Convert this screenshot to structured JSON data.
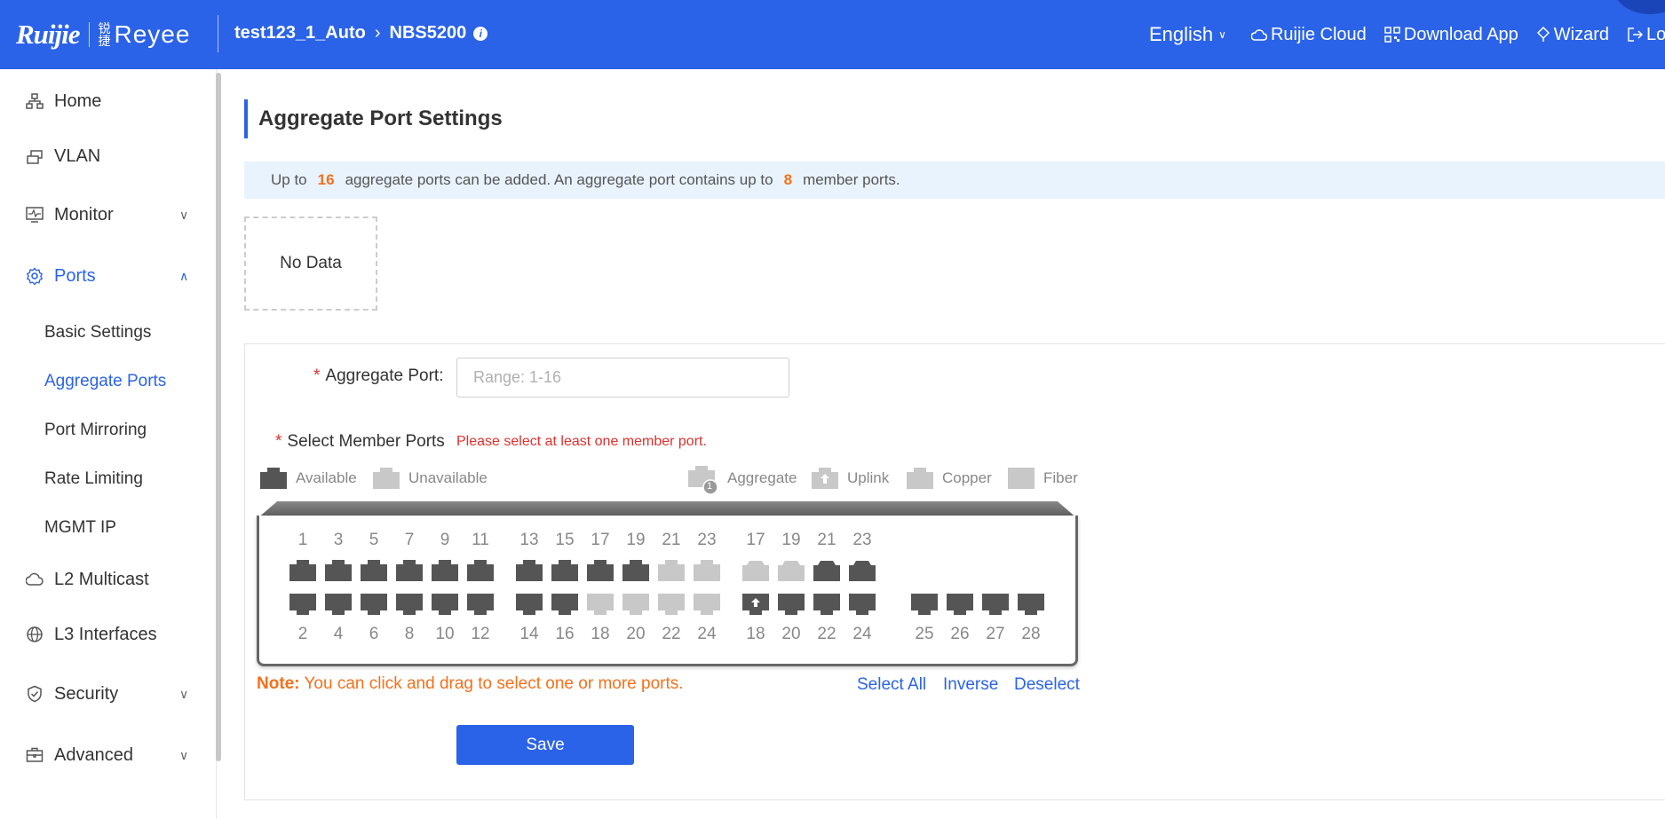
{
  "header": {
    "logo_ruijie": "Ruijie",
    "logo_reyee": "Reyee",
    "logo_reyee_cn": "锐捷",
    "device_name": "test123_1_Auto",
    "model": "NBS5200",
    "language": "English",
    "nav": [
      {
        "label": "Ruijie Cloud",
        "icon": "cloud-icon"
      },
      {
        "label": "Download App",
        "icon": "qrcode-icon"
      },
      {
        "label": "Wizard",
        "icon": "wizard-icon"
      },
      {
        "label": "Log",
        "icon": "logout-icon"
      }
    ]
  },
  "sidebar": {
    "items": [
      {
        "label": "Home",
        "icon": "network-icon"
      },
      {
        "label": "VLAN",
        "icon": "vlan-icon"
      },
      {
        "label": "Monitor",
        "icon": "monitor-icon"
      },
      {
        "label": "Ports",
        "icon": "gear-icon"
      },
      {
        "label": "L2 Multicast",
        "icon": "cloud-icon"
      },
      {
        "label": "L3 Interfaces",
        "icon": "globe-icon"
      },
      {
        "label": "Security",
        "icon": "shield-icon"
      },
      {
        "label": "Advanced",
        "icon": "toolbox-icon"
      }
    ],
    "ports_sub": [
      "Basic Settings",
      "Aggregate Ports",
      "Port Mirroring",
      "Rate Limiting",
      "MGMT IP"
    ]
  },
  "main": {
    "title": "Aggregate Port Settings",
    "banner": {
      "prefix": "Up to",
      "max_aggregate": "16",
      "middle": "aggregate ports can be added. An aggregate port contains up to",
      "max_members": "8",
      "suffix": "member ports."
    },
    "no_data": "No Data",
    "form": {
      "aggregate_port_label": "Aggregate Port:",
      "aggregate_port_placeholder": "Range: 1-16",
      "aggregate_port_value": "",
      "member_ports_label": "Select Member Ports",
      "member_ports_error": "Please select at least one member port.",
      "required_mark": "*"
    },
    "legend": {
      "available": "Available",
      "unavailable": "Unavailable",
      "aggregate": "Aggregate",
      "aggregate_badge": "1",
      "uplink": "Uplink",
      "copper": "Copper",
      "fiber": "Fiber"
    },
    "note_label": "Note:",
    "note_text": "You can click and drag to select one or more ports.",
    "actions": {
      "select_all": "Select All",
      "inverse": "Inverse",
      "deselect": "Deselect"
    },
    "save_label": "Save"
  },
  "colors": {
    "primary": "#2b63e8",
    "available": "#555555",
    "unavailable": "#c8c8c8",
    "warning": "#f5701a",
    "error": "#e0302d"
  },
  "ports": {
    "copper_top": [
      {
        "n": "1",
        "state": "available"
      },
      {
        "n": "3",
        "state": "available"
      },
      {
        "n": "5",
        "state": "available"
      },
      {
        "n": "7",
        "state": "available"
      },
      {
        "n": "9",
        "state": "available"
      },
      {
        "n": "11",
        "state": "available"
      },
      {
        "n": "13",
        "state": "available"
      },
      {
        "n": "15",
        "state": "available"
      },
      {
        "n": "17",
        "state": "available"
      },
      {
        "n": "19",
        "state": "available"
      },
      {
        "n": "21",
        "state": "unavailable"
      },
      {
        "n": "23",
        "state": "unavailable"
      }
    ],
    "copper_bottom": [
      {
        "n": "2",
        "state": "available"
      },
      {
        "n": "4",
        "state": "available"
      },
      {
        "n": "6",
        "state": "available"
      },
      {
        "n": "8",
        "state": "available"
      },
      {
        "n": "10",
        "state": "available"
      },
      {
        "n": "12",
        "state": "available"
      },
      {
        "n": "14",
        "state": "available"
      },
      {
        "n": "16",
        "state": "available"
      },
      {
        "n": "18",
        "state": "unavailable"
      },
      {
        "n": "20",
        "state": "unavailable"
      },
      {
        "n": "22",
        "state": "unavailable"
      },
      {
        "n": "24",
        "state": "unavailable"
      }
    ],
    "fiber_top": [
      {
        "n": "17",
        "state": "unavailable"
      },
      {
        "n": "19",
        "state": "unavailable"
      },
      {
        "n": "21",
        "state": "available"
      },
      {
        "n": "23",
        "state": "available"
      }
    ],
    "fiber_bottom": [
      {
        "n": "18",
        "state": "uplink"
      },
      {
        "n": "20",
        "state": "available"
      },
      {
        "n": "22",
        "state": "available"
      },
      {
        "n": "24",
        "state": "available"
      }
    ],
    "extra_bottom": [
      {
        "n": "25",
        "state": "available"
      },
      {
        "n": "26",
        "state": "available"
      },
      {
        "n": "27",
        "state": "available"
      },
      {
        "n": "28",
        "state": "available"
      }
    ]
  }
}
